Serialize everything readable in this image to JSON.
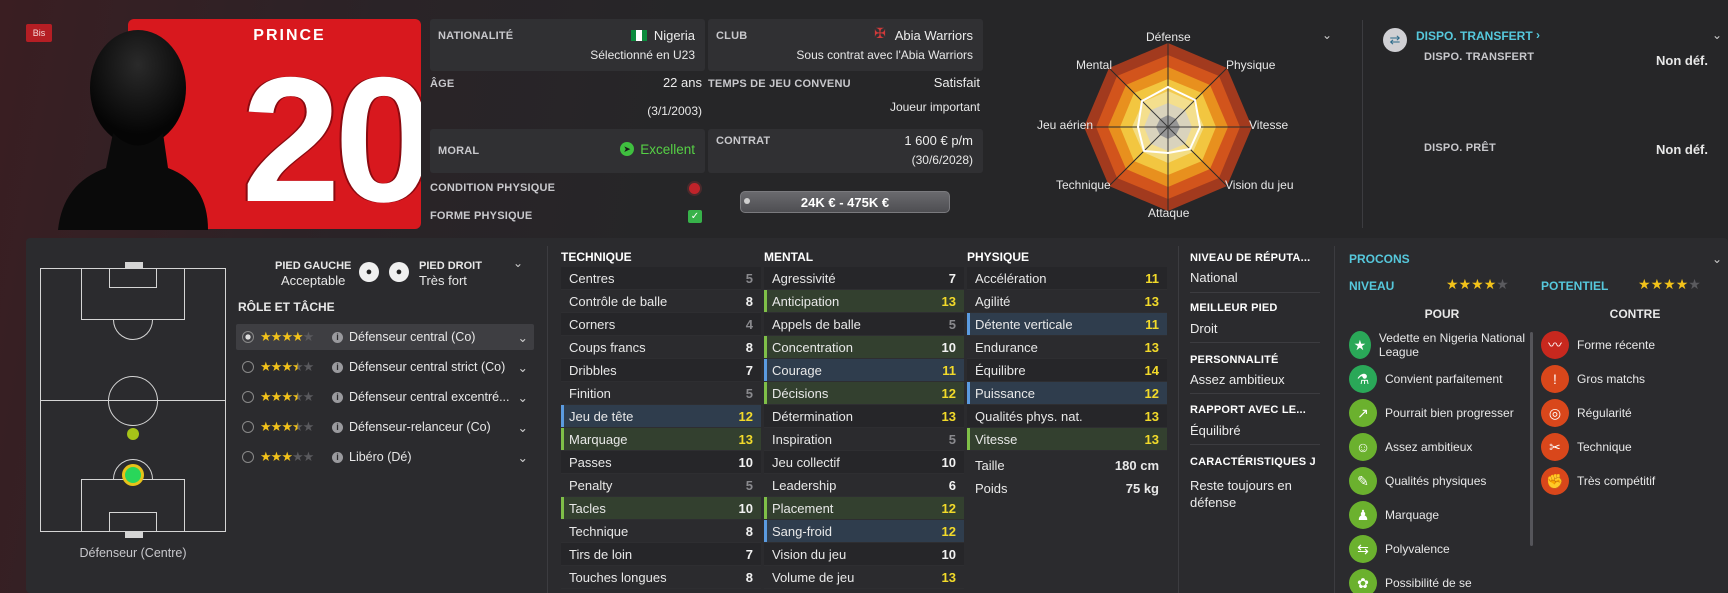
{
  "player": {
    "badge": "Bis",
    "shirt_name": "PRINCE",
    "shirt_number": "20"
  },
  "info": {
    "nationality": {
      "label": "NATIONALITÉ",
      "value": "Nigeria",
      "sub": "Sélectionné en U23"
    },
    "club": {
      "label": "CLUB",
      "value": "Abia Warriors",
      "sub": "Sous contrat avec l'Abia Warriors"
    },
    "age": {
      "label": "ÂGE",
      "value": "22 ans",
      "sub": "(3/1/2003)"
    },
    "playing_time": {
      "label": "TEMPS DE JEU CONVENU",
      "value": "Satisfait",
      "sub": "Joueur important"
    },
    "morale": {
      "label": "MORAL",
      "value": "Excellent"
    },
    "contract": {
      "label": "CONTRAT",
      "value": "1 600 € p/m",
      "sub": "(30/6/2028)"
    },
    "condition": {
      "label": "CONDITION PHYSIQUE"
    },
    "match_sharpness": {
      "label": "FORME PHYSIQUE"
    },
    "transfer_value": "24K € - 475K €"
  },
  "radar": {
    "labels": [
      "Défense",
      "Physique",
      "Vitesse",
      "Vision du jeu",
      "Attaque",
      "Technique",
      "Jeu aérien",
      "Mental"
    ]
  },
  "transfer": {
    "title": "DISPO. TRANSFERT",
    "transfer_label": "DISPO. TRANSFERT",
    "transfer_value": "Non déf.",
    "loan_label": "DISPO. PRÊT",
    "loan_value": "Non déf."
  },
  "feet": {
    "left_label": "PIED GAUCHE",
    "left_value": "Acceptable",
    "right_label": "PIED DROIT",
    "right_value": "Très fort"
  },
  "roles": {
    "title": "RÔLE ET TÂCHE",
    "items": [
      {
        "name": "Défenseur central (Co)",
        "stars": 4,
        "half": false
      },
      {
        "name": "Défenseur central strict (Co)",
        "stars": 3,
        "half": true
      },
      {
        "name": "Défenseur central excentré...",
        "stars": 3,
        "half": true
      },
      {
        "name": "Défenseur-relanceur (Co)",
        "stars": 3,
        "half": true
      },
      {
        "name": "Libéro (Dé)",
        "stars": 3,
        "half": false
      }
    ]
  },
  "position": {
    "label": "Défenseur (Centre)"
  },
  "technique": {
    "title": "TECHNIQUE",
    "rows": [
      [
        "Centres",
        "5",
        "dim",
        ""
      ],
      [
        "Contrôle de balle",
        "8",
        "wh",
        ""
      ],
      [
        "Corners",
        "4",
        "dim",
        ""
      ],
      [
        "Coups francs",
        "8",
        "wh",
        ""
      ],
      [
        "Dribbles",
        "7",
        "wh",
        ""
      ],
      [
        "Finition",
        "5",
        "dim",
        ""
      ],
      [
        "Jeu de tête",
        "12",
        "yl",
        "blue"
      ],
      [
        "Marquage",
        "13",
        "yl",
        "green"
      ],
      [
        "Passes",
        "10",
        "wh",
        ""
      ],
      [
        "Penalty",
        "5",
        "dim",
        ""
      ],
      [
        "Tacles",
        "10",
        "wh",
        "green"
      ],
      [
        "Technique",
        "8",
        "wh",
        ""
      ],
      [
        "Tirs de loin",
        "7",
        "wh",
        ""
      ],
      [
        "Touches longues",
        "8",
        "wh",
        ""
      ]
    ]
  },
  "mental": {
    "title": "MENTAL",
    "rows": [
      [
        "Agressivité",
        "7",
        "wh",
        ""
      ],
      [
        "Anticipation",
        "13",
        "yl",
        "green"
      ],
      [
        "Appels de balle",
        "5",
        "dim",
        ""
      ],
      [
        "Concentration",
        "10",
        "wh",
        "green"
      ],
      [
        "Courage",
        "11",
        "yl",
        "blue"
      ],
      [
        "Décisions",
        "12",
        "yl",
        "green"
      ],
      [
        "Détermination",
        "13",
        "yl",
        ""
      ],
      [
        "Inspiration",
        "5",
        "dim",
        ""
      ],
      [
        "Jeu collectif",
        "10",
        "wh",
        ""
      ],
      [
        "Leadership",
        "6",
        "wh",
        ""
      ],
      [
        "Placement",
        "12",
        "yl",
        "green"
      ],
      [
        "Sang-froid",
        "12",
        "yl",
        "blue"
      ],
      [
        "Vision du jeu",
        "10",
        "wh",
        ""
      ],
      [
        "Volume de jeu",
        "13",
        "yl",
        ""
      ]
    ]
  },
  "physique": {
    "title": "PHYSIQUE",
    "rows": [
      [
        "Accélération",
        "11",
        "yl",
        ""
      ],
      [
        "Agilité",
        "13",
        "yl",
        ""
      ],
      [
        "Détente verticale",
        "11",
        "yl",
        "blue"
      ],
      [
        "Endurance",
        "13",
        "yl",
        ""
      ],
      [
        "Équilibre",
        "14",
        "yl",
        ""
      ],
      [
        "Puissance",
        "12",
        "yl",
        "blue"
      ],
      [
        "Qualités phys. nat.",
        "13",
        "yl",
        ""
      ],
      [
        "Vitesse",
        "13",
        "yl",
        "green"
      ]
    ],
    "height_label": "Taille",
    "height_value": "180 cm",
    "weight_label": "Poids",
    "weight_value": "75 kg"
  },
  "profile": {
    "reputation_label": "NIVEAU DE RÉPUTA...",
    "reputation_value": "National",
    "best_foot_label": "MEILLEUR PIED",
    "best_foot_value": "Droit",
    "personality_label": "PERSONNALITÉ",
    "personality_value": "Assez ambitieux",
    "media_label": "RAPPORT AVEC LE...",
    "media_value": "Équilibré",
    "traits_label": "CARACTÉRISTIQUES J",
    "traits_value": "Reste toujours en défense"
  },
  "procons": {
    "title": "PROCONS",
    "level_label": "NIVEAU",
    "level_stars": 4,
    "potential_label": "POTENTIEL",
    "potential_stars": 4,
    "pros_title": "POUR",
    "cons_title": "CONTRE",
    "pros": [
      {
        "text": "Vedette en Nigeria National League",
        "icon": "star-icon",
        "color": "#2aa858"
      },
      {
        "text": "Convient parfaitement",
        "icon": "flask-icon",
        "color": "#2aa858"
      },
      {
        "text": "Pourrait bien progresser",
        "icon": "trend-icon",
        "color": "#6bb12e"
      },
      {
        "text": "Assez ambitieux",
        "icon": "head-icon",
        "color": "#6bb12e"
      },
      {
        "text": "Qualités physiques",
        "icon": "bone-icon",
        "color": "#6bb12e"
      },
      {
        "text": "Marquage",
        "icon": "marking-icon",
        "color": "#6bb12e"
      },
      {
        "text": "Polyvalence",
        "icon": "versatile-icon",
        "color": "#6bb12e"
      },
      {
        "text": "Possibilité de se",
        "icon": "growth-icon",
        "color": "#6bb12e"
      }
    ],
    "cons": [
      {
        "text": "Forme récente",
        "icon": "form-icon",
        "color": "#c8281e"
      },
      {
        "text": "Gros matchs",
        "icon": "big-match-icon",
        "color": "#d9471b"
      },
      {
        "text": "Régularité",
        "icon": "target-icon",
        "color": "#d9471b"
      },
      {
        "text": "Technique",
        "icon": "wrench-icon",
        "color": "#d9471b"
      },
      {
        "text": "Très compétitif",
        "icon": "competitive-icon",
        "color": "#d9471b"
      }
    ]
  }
}
